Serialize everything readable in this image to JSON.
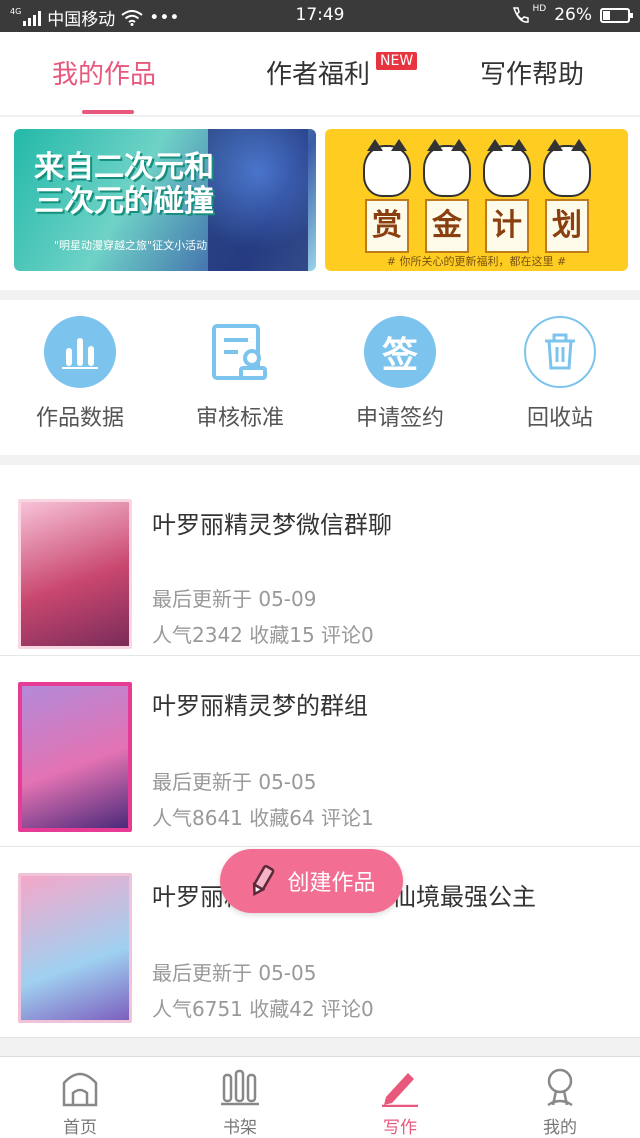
{
  "status_bar": {
    "network": "4G",
    "carrier": "中国移动",
    "more": "•••",
    "time": "17:49",
    "hd": "HD",
    "battery": "26%",
    "battery_level": 0.26
  },
  "tabs": [
    {
      "label": "我的作品",
      "active": true
    },
    {
      "label": "作者福利",
      "active": false,
      "badge": "NEW"
    },
    {
      "label": "写作帮助",
      "active": false
    }
  ],
  "banners": {
    "left": {
      "title_line1": "来自二次元和",
      "title_line2": "三次元的碰撞",
      "subtitle": "\"明星动漫穿越之旅\"征文小活动"
    },
    "right": {
      "chars": [
        "赏",
        "金",
        "计",
        "划"
      ],
      "footer": "# 你所关心的更新福利，都在这里 #"
    }
  },
  "quick_actions": [
    {
      "label": "作品数据",
      "icon": "bar-chart-icon"
    },
    {
      "label": "审核标准",
      "icon": "review-doc-icon"
    },
    {
      "label": "申请签约",
      "icon": "sign-icon",
      "glyph": "签"
    },
    {
      "label": "回收站",
      "icon": "trash-icon"
    }
  ],
  "works": [
    {
      "title": "叶罗丽精灵梦微信群聊",
      "updated": "最后更新于 05-09",
      "stats": "人气2342 收藏15 评论0"
    },
    {
      "title": "叶罗丽精灵梦的群组",
      "updated": "最后更新于 05-05",
      "stats": "人气8641 收藏64 评论1"
    },
    {
      "title": "叶罗丽精灵梦之叶罗丽仙境最强公主",
      "updated": "最后更新于 05-05",
      "stats": "人气6751 收藏42 评论0"
    }
  ],
  "create_button": {
    "label": "创建作品"
  },
  "bottom_nav": [
    {
      "label": "首页",
      "icon": "home-icon",
      "active": false
    },
    {
      "label": "书架",
      "icon": "bookshelf-icon",
      "active": false
    },
    {
      "label": "写作",
      "icon": "pen-icon",
      "active": true
    },
    {
      "label": "我的",
      "icon": "profile-icon",
      "active": false
    }
  ],
  "colors": {
    "accent": "#e8587c",
    "icon_blue": "#7cc4ee",
    "new_badge": "#e8343f",
    "fab": "#f26e93"
  }
}
